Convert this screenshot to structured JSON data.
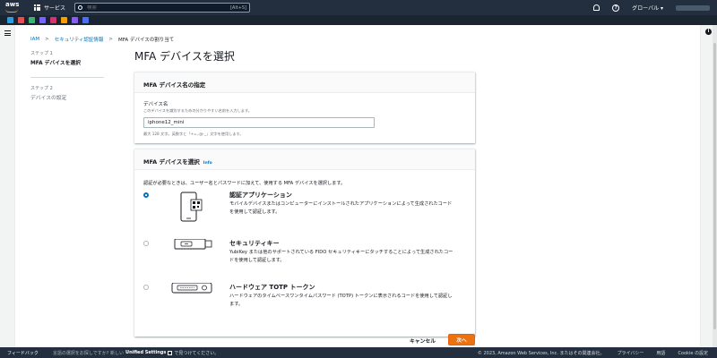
{
  "topnav": {
    "services_label": "サービス",
    "search_placeholder": "検索",
    "search_shortcut": "[Alt+S]",
    "region": "グローバル ▾"
  },
  "favorites": {
    "colors": [
      "#2d9cdb",
      "#e94e4e",
      "#3bb273",
      "#7b61ff",
      "#d6336c",
      "#f59f00",
      "#8a5cf6",
      "#4c6ef5"
    ]
  },
  "breadcrumb": {
    "items": [
      "IAM",
      "セキュリティ認証情報",
      "MFA デバイスの割り当て"
    ]
  },
  "steps": [
    {
      "label": "ステップ 1",
      "title": "MFA デバイスを選択"
    },
    {
      "label": "ステップ 2",
      "title": "デバイスの設定"
    }
  ],
  "page_title": "MFA デバイスを選択",
  "device_name_card": {
    "header": "MFA デバイス名の指定",
    "field_label": "デバイス名",
    "field_description": "このデバイスを識別するための分かりやすい名前を入力します。",
    "field_value": "iphone12_mini",
    "field_constraint": "最大 128 文字。英数字と「+=,.@-_」文字を使用します。"
  },
  "device_type_card": {
    "header": "MFA デバイスを選択",
    "info_link": "Info",
    "description": "認証が必要なときは、ユーザー名とパスワードに加えて、使用する MFA デバイスを選択します。",
    "options": [
      {
        "title": "認証アプリケーション",
        "description": "モバイルデバイスまたはコンピューターにインストールされたアプリケーションによって生成されたコードを使用して認証します。",
        "selected": true,
        "icon": "phone-qr-icon"
      },
      {
        "title": "セキュリティキー",
        "description": "YubiKey または他のサポートされている FIDO セキュリティキーにタッチすることによって生成されたコードを使用して認証します。",
        "selected": false,
        "icon": "security-key-icon"
      },
      {
        "title": "ハードウェア TOTP トークン",
        "description": "ハードウェアのタイムベースワンタイムパスワード (TOTP) トークンに表示されるコードを使用して認証します。",
        "selected": false,
        "icon": "totp-token-icon"
      }
    ]
  },
  "actions": {
    "cancel": "キャンセル",
    "next": "次へ"
  },
  "footer": {
    "feedback": "フィードバック",
    "lang_text": "言語の選択をお探しですか? 新しい",
    "unified_settings": "Unified Settings",
    "lang_text_after": "で見つけてください。",
    "copyright": "© 2023, Amazon Web Services, Inc. またはその関連会社。",
    "privacy": "プライバシー",
    "terms": "用語",
    "cookie": "Cookie の設定"
  }
}
